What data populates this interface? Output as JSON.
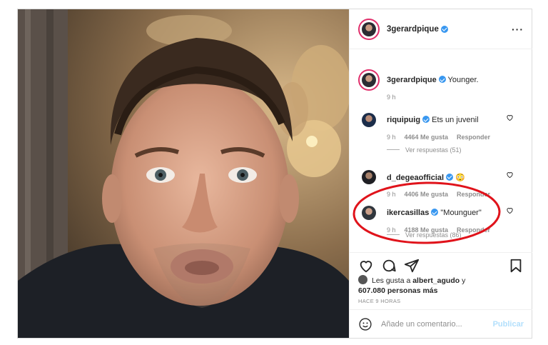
{
  "post": {
    "author": "3gerardpique",
    "more_icon": "more-horizontal-icon"
  },
  "caption": {
    "username": "3gerardpique",
    "text": "Younger.",
    "time": "9 h"
  },
  "comments": [
    {
      "username": "riquipuig",
      "text": "Ets un juvenil",
      "time": "9 h",
      "likes": "4464 Me gusta",
      "reply": "Responder",
      "view_replies": "Ver respuestas (51)"
    },
    {
      "username": "d_degeaofficial",
      "text": "😳",
      "time": "9 h",
      "likes": "4406 Me gusta",
      "reply": "Responder"
    },
    {
      "username": "ikercasillas",
      "text": "\"Mounguer\"",
      "time": "9 h",
      "likes": "4188 Me gusta",
      "reply": "Responder",
      "view_replies": "Ver respuestas (86)"
    }
  ],
  "likes": {
    "prefix": "Les gusta a",
    "user": "albert_agudo",
    "suffix": "y",
    "others": "607.080 personas más"
  },
  "timestamp": "HACE 9 HORAS",
  "composer": {
    "placeholder": "Añade un comentario...",
    "publish": "Publicar"
  },
  "colors": {
    "verified": "#3897f0",
    "annotation": "#e0131b",
    "story_ring": "#e1306c"
  }
}
